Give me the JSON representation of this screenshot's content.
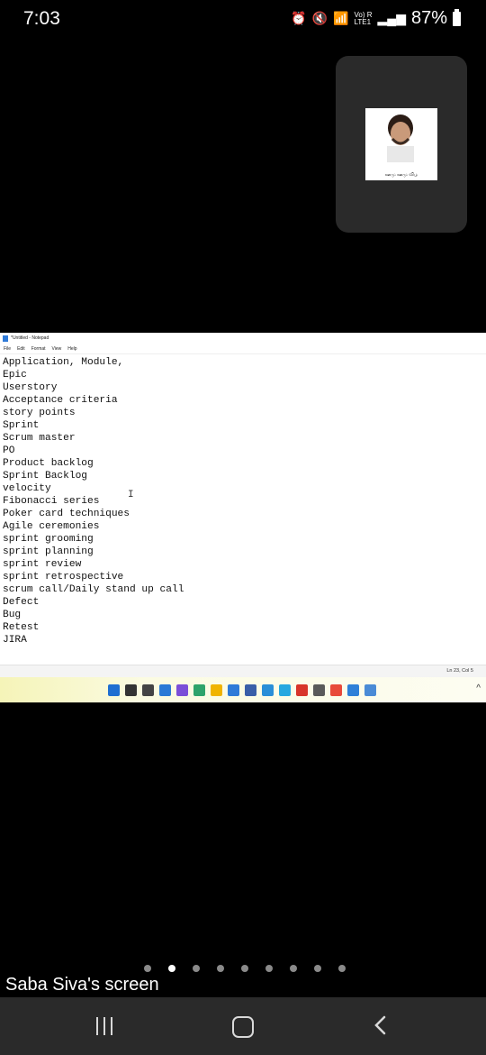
{
  "status_bar": {
    "time": "7:03",
    "network_label": "Vo) R\nLTE1",
    "battery_percent": "87%"
  },
  "participant_tile": {
    "caption": "ஊமு ஊமு விழ"
  },
  "notepad": {
    "title": "*Untitled - Notepad",
    "menu": [
      "File",
      "Edit",
      "Format",
      "View",
      "Help"
    ],
    "lines": [
      "Application, Module,",
      "Epic",
      "Userstory",
      "Acceptance criteria",
      "story points",
      "Sprint",
      "Scrum master",
      "PO",
      "Product backlog",
      "Sprint Backlog",
      "velocity",
      "Fibonacci series",
      "Poker card techniques",
      "Agile ceremonies",
      "sprint grooming",
      "sprint planning",
      "sprint review",
      "sprint retrospective",
      "scrum call/Daily stand up call",
      "Defect",
      "Bug",
      "Retest",
      "JIRA"
    ],
    "cursor_position": "Ln 23, Col 5"
  },
  "taskbar": {
    "icon_colors": [
      "#1f6fd1",
      "#333333",
      "#444444",
      "#2a7ad6",
      "#7b4fd8",
      "#2ea36b",
      "#f0b400",
      "#2f7bd8",
      "#3a5fa8",
      "#2a8fd8",
      "#27a8e0",
      "#d8352a",
      "#5a5a5a",
      "#e84a3a",
      "#2f80d8",
      "#4a8bd6"
    ]
  },
  "pager": {
    "dot_count": 9,
    "active_index": 1
  },
  "screen_owner": "Saba Siva's screen"
}
